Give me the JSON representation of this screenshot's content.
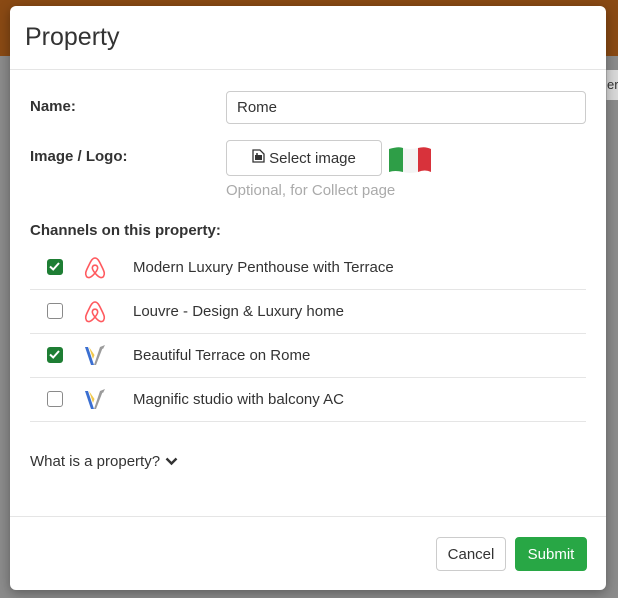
{
  "backdrop": {
    "peek_text": "er"
  },
  "modal": {
    "title": "Property",
    "name_label": "Name:",
    "name_value": "Rome",
    "image_label": "Image / Logo:",
    "select_image_label": "Select image",
    "image_hint": "Optional, for Collect page",
    "flag_icon": "italy-flag",
    "channels_heading": "Channels on this property:",
    "channels": [
      {
        "name": "Modern Luxury Penthouse with Terrace",
        "checked": true,
        "icon": "airbnb-icon"
      },
      {
        "name": "Louvre - Design & Luxury home",
        "checked": false,
        "icon": "airbnb-icon"
      },
      {
        "name": "Beautiful Terrace on Rome",
        "checked": true,
        "icon": "vrbo-icon"
      },
      {
        "name": "Magnific studio with balcony AC",
        "checked": false,
        "icon": "vrbo-icon"
      }
    ],
    "what_is_link": "What is a property?",
    "cancel_label": "Cancel",
    "submit_label": "Submit"
  },
  "colors": {
    "submit": "#28a745",
    "checkbox_checked": "#1e7e34",
    "airbnb": "#ff5a5f",
    "header_backdrop": "#8a4a14"
  }
}
